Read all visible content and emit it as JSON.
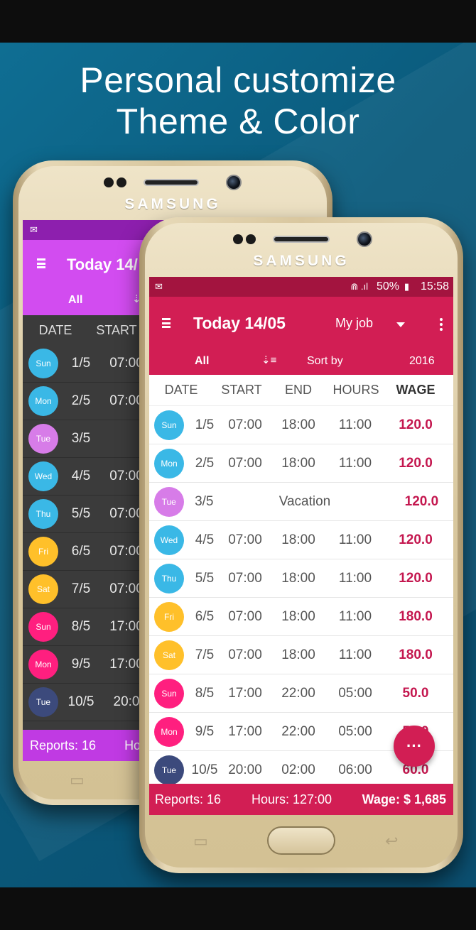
{
  "headline": {
    "line1": "Personal customize",
    "line2": "Theme & Color"
  },
  "brand": "SAMSUNG",
  "back_phone": {
    "title": "Today 14/",
    "filter": "All",
    "columns": [
      "DATE",
      "START"
    ],
    "rows": [
      {
        "day": "Sun",
        "date": "1/5",
        "start": "07:00",
        "color": "#3ab8e6"
      },
      {
        "day": "Mon",
        "date": "2/5",
        "start": "07:00",
        "color": "#3ab8e6"
      },
      {
        "day": "Tue",
        "date": "3/5",
        "start": "",
        "color": "#d77ce8"
      },
      {
        "day": "Wed",
        "date": "4/5",
        "start": "07:00",
        "color": "#3ab8e6"
      },
      {
        "day": "Thu",
        "date": "5/5",
        "start": "07:00",
        "color": "#3ab8e6"
      },
      {
        "day": "Fri",
        "date": "6/5",
        "start": "07:00",
        "color": "#ffc02a"
      },
      {
        "day": "Sat",
        "date": "7/5",
        "start": "07:00",
        "color": "#ffc02a"
      },
      {
        "day": "Sun",
        "date": "8/5",
        "start": "17:00",
        "color": "#ff1f7f"
      },
      {
        "day": "Mon",
        "date": "9/5",
        "start": "17:00",
        "color": "#ff1f7f"
      },
      {
        "day": "Tue",
        "date": "10/5",
        "start": "20:0",
        "color": "#3c4a7c"
      }
    ],
    "footer_reports": "Reports: 16",
    "footer_hours": "Ho"
  },
  "front_phone": {
    "status": {
      "battery": "50%",
      "time": "15:58"
    },
    "title": "Today 14/05",
    "job": "My job",
    "filter": "All",
    "sort": "Sort by",
    "year": "2016",
    "columns": [
      "DATE",
      "START",
      "END",
      "HOURS",
      "WAGE"
    ],
    "rows": [
      {
        "day": "Sun",
        "date": "1/5",
        "start": "07:00",
        "end": "18:00",
        "hours": "11:00",
        "wage": "120.0",
        "color": "#3ab8e6"
      },
      {
        "day": "Mon",
        "date": "2/5",
        "start": "07:00",
        "end": "18:00",
        "hours": "11:00",
        "wage": "120.0",
        "color": "#3ab8e6"
      },
      {
        "day": "Tue",
        "date": "3/5",
        "note": "Vacation",
        "wage": "120.0",
        "color": "#d77ce8"
      },
      {
        "day": "Wed",
        "date": "4/5",
        "start": "07:00",
        "end": "18:00",
        "hours": "11:00",
        "wage": "120.0",
        "color": "#3ab8e6"
      },
      {
        "day": "Thu",
        "date": "5/5",
        "start": "07:00",
        "end": "18:00",
        "hours": "11:00",
        "wage": "120.0",
        "color": "#3ab8e6"
      },
      {
        "day": "Fri",
        "date": "6/5",
        "start": "07:00",
        "end": "18:00",
        "hours": "11:00",
        "wage": "180.0",
        "color": "#ffc02a"
      },
      {
        "day": "Sat",
        "date": "7/5",
        "start": "07:00",
        "end": "18:00",
        "hours": "11:00",
        "wage": "180.0",
        "color": "#ffc02a"
      },
      {
        "day": "Sun",
        "date": "8/5",
        "start": "17:00",
        "end": "22:00",
        "hours": "05:00",
        "wage": "50.0",
        "color": "#ff1f7f"
      },
      {
        "day": "Mon",
        "date": "9/5",
        "start": "17:00",
        "end": "22:00",
        "hours": "05:00",
        "wage": "50.0",
        "color": "#ff1f7f"
      },
      {
        "day": "Tue",
        "date": "10/5",
        "start": "20:00",
        "end": "02:00",
        "hours": "06:00",
        "wage": "60.0",
        "color": "#3c4a7c"
      }
    ],
    "footer": {
      "reports": "Reports: 16",
      "hours": "Hours: 127:00",
      "wage": "Wage: $ 1,685"
    },
    "fab_label": "···"
  },
  "colors": {
    "front_accent": "#d21e54",
    "back_accent": "#d24cf0"
  }
}
